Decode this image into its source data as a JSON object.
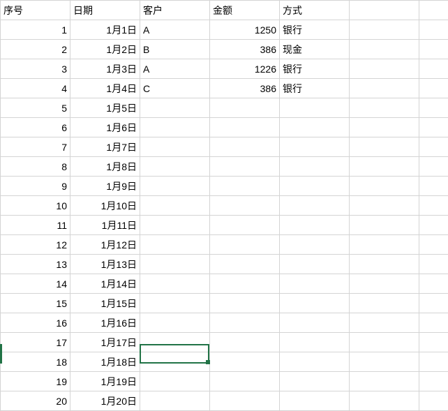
{
  "headers": {
    "num": "序号",
    "date": "日期",
    "customer": "客户",
    "amount": "金额",
    "method": "方式"
  },
  "rows": [
    {
      "num": "1",
      "date": "1月1日",
      "customer": "A",
      "amount": "1250",
      "method": "银行"
    },
    {
      "num": "2",
      "date": "1月2日",
      "customer": "B",
      "amount": "386",
      "method": "现金"
    },
    {
      "num": "3",
      "date": "1月3日",
      "customer": "A",
      "amount": "1226",
      "method": "银行"
    },
    {
      "num": "4",
      "date": "1月4日",
      "customer": "C",
      "amount": "386",
      "method": "银行"
    },
    {
      "num": "5",
      "date": "1月5日",
      "customer": "",
      "amount": "",
      "method": ""
    },
    {
      "num": "6",
      "date": "1月6日",
      "customer": "",
      "amount": "",
      "method": ""
    },
    {
      "num": "7",
      "date": "1月7日",
      "customer": "",
      "amount": "",
      "method": ""
    },
    {
      "num": "8",
      "date": "1月8日",
      "customer": "",
      "amount": "",
      "method": ""
    },
    {
      "num": "9",
      "date": "1月9日",
      "customer": "",
      "amount": "",
      "method": ""
    },
    {
      "num": "10",
      "date": "1月10日",
      "customer": "",
      "amount": "",
      "method": ""
    },
    {
      "num": "11",
      "date": "1月11日",
      "customer": "",
      "amount": "",
      "method": ""
    },
    {
      "num": "12",
      "date": "1月12日",
      "customer": "",
      "amount": "",
      "method": ""
    },
    {
      "num": "13",
      "date": "1月13日",
      "customer": "",
      "amount": "",
      "method": ""
    },
    {
      "num": "14",
      "date": "1月14日",
      "customer": "",
      "amount": "",
      "method": ""
    },
    {
      "num": "15",
      "date": "1月15日",
      "customer": "",
      "amount": "",
      "method": ""
    },
    {
      "num": "16",
      "date": "1月16日",
      "customer": "",
      "amount": "",
      "method": ""
    },
    {
      "num": "17",
      "date": "1月17日",
      "customer": "",
      "amount": "",
      "method": ""
    },
    {
      "num": "18",
      "date": "1月18日",
      "customer": "",
      "amount": "",
      "method": ""
    },
    {
      "num": "19",
      "date": "1月19日",
      "customer": "",
      "amount": "",
      "method": ""
    },
    {
      "num": "20",
      "date": "1月20日",
      "customer": "",
      "amount": "",
      "method": ""
    }
  ],
  "selection": {
    "row_index": 17,
    "col_name": "customer"
  }
}
